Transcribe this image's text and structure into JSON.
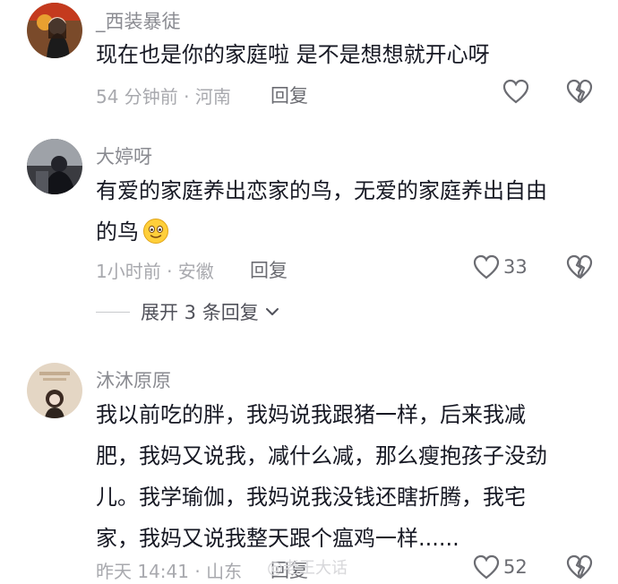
{
  "comments": [
    {
      "username": "_西装暴徒",
      "lines": [
        "现在也是你的家庭啦  是不是想想就开心呀"
      ],
      "meta": "54 分钟前 · 河南",
      "reply_label": "回复",
      "likes": ""
    },
    {
      "username": "大婷呀",
      "lines": [
        "有爱的家庭养出恋家的鸟，无爱的家庭养出自由",
        "的鸟"
      ],
      "meta": "1小时前 · 安徽",
      "reply_label": "回复",
      "likes": "33",
      "expand_label": "展开 3 条回复"
    },
    {
      "username": "沐沐原原",
      "lines": [
        "我以前吃的胖，我妈说我跟猪一样，后来我减",
        "肥，我妈又说我，减什么减，那么瘦抱孩子没劲",
        "儿。我学瑜伽，我妈说我没钱还瞎折腾，我宅",
        "家，我妈又说我整天跟个瘟鸡一样......"
      ],
      "meta": "昨天 14:41 · 山东",
      "reply_label": "回复",
      "likes": "52"
    }
  ],
  "watermark": "@老王大话",
  "icons": {
    "like": "heart-outline-icon",
    "dislike": "broken-heart-icon",
    "expand": "chevron-down-icon",
    "emoji": "smiling-face-emoji"
  }
}
